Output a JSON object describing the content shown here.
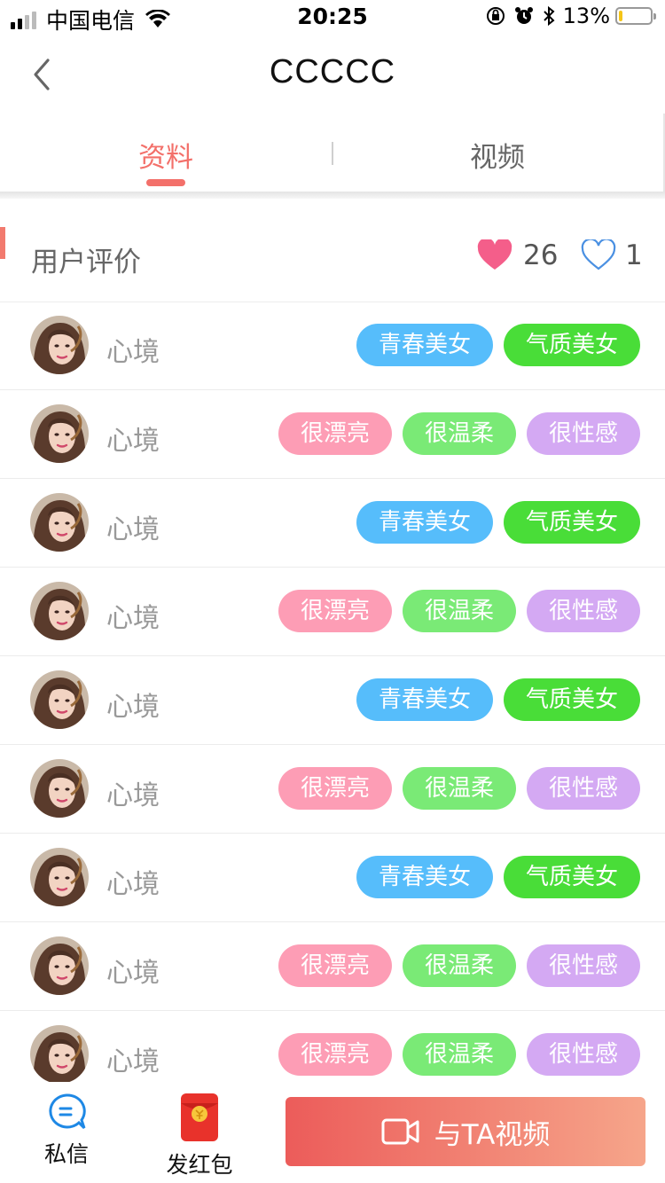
{
  "status_bar": {
    "carrier": "中国电信",
    "time": "20:25",
    "battery": "13%",
    "battery_level": 0.13,
    "icons": [
      "signal-icon",
      "wifi-icon",
      "orientation-lock-icon",
      "alarm-icon",
      "bluetooth-icon",
      "battery-icon"
    ]
  },
  "nav": {
    "title": "CCCCC",
    "back_icon": "chevron-left-icon"
  },
  "tabs": [
    {
      "label": "资料",
      "active": true
    },
    {
      "label": "视频",
      "active": false
    }
  ],
  "colors": {
    "accent": "#f3706a",
    "heart_fill": "#f45e8a",
    "heart_outline": "#4a90e2",
    "tag_blue": "#56bdfb",
    "tag_green": "#49dd38",
    "tag_pink": "#fd9db5",
    "tag_lightgreen": "#7aea76",
    "tag_purple": "#d4a9f3"
  },
  "review_header": {
    "title": "用户评价",
    "like_count": "26",
    "dislike_count": "1"
  },
  "reviews": [
    {
      "name": "心境",
      "tags": [
        {
          "text": "青春美女",
          "color": "#56bdfb"
        },
        {
          "text": "气质美女",
          "color": "#49dd38"
        }
      ]
    },
    {
      "name": "心境",
      "tags": [
        {
          "text": "很漂亮",
          "color": "#fd9db5"
        },
        {
          "text": "很温柔",
          "color": "#7aea76"
        },
        {
          "text": "很性感",
          "color": "#d4a9f3"
        }
      ]
    },
    {
      "name": "心境",
      "tags": [
        {
          "text": "青春美女",
          "color": "#56bdfb"
        },
        {
          "text": "气质美女",
          "color": "#49dd38"
        }
      ]
    },
    {
      "name": "心境",
      "tags": [
        {
          "text": "很漂亮",
          "color": "#fd9db5"
        },
        {
          "text": "很温柔",
          "color": "#7aea76"
        },
        {
          "text": "很性感",
          "color": "#d4a9f3"
        }
      ]
    },
    {
      "name": "心境",
      "tags": [
        {
          "text": "青春美女",
          "color": "#56bdfb"
        },
        {
          "text": "气质美女",
          "color": "#49dd38"
        }
      ]
    },
    {
      "name": "心境",
      "tags": [
        {
          "text": "很漂亮",
          "color": "#fd9db5"
        },
        {
          "text": "很温柔",
          "color": "#7aea76"
        },
        {
          "text": "很性感",
          "color": "#d4a9f3"
        }
      ]
    },
    {
      "name": "心境",
      "tags": [
        {
          "text": "青春美女",
          "color": "#56bdfb"
        },
        {
          "text": "气质美女",
          "color": "#49dd38"
        }
      ]
    },
    {
      "name": "心境",
      "tags": [
        {
          "text": "很漂亮",
          "color": "#fd9db5"
        },
        {
          "text": "很温柔",
          "color": "#7aea76"
        },
        {
          "text": "很性感",
          "color": "#d4a9f3"
        }
      ]
    },
    {
      "name": "心境",
      "tags": [
        {
          "text": "很漂亮",
          "color": "#fd9db5"
        },
        {
          "text": "很温柔",
          "color": "#7aea76"
        },
        {
          "text": "很性感",
          "color": "#d4a9f3"
        }
      ]
    }
  ],
  "bottom_bar": {
    "message_label": "私信",
    "message_icon": "chat-bubble-icon",
    "red_packet_label": "发红包",
    "red_packet_icon": "red-envelope-icon",
    "video_button_label": "与TA视频",
    "video_icon": "video-camera-icon"
  }
}
